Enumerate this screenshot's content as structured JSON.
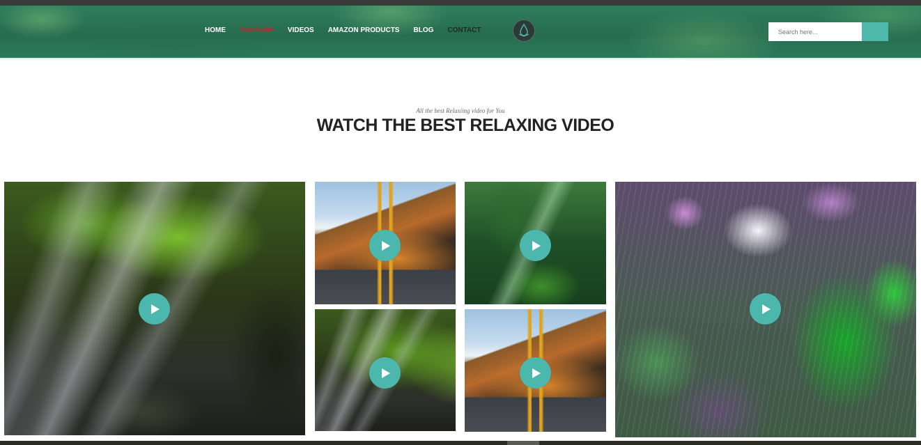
{
  "nav": {
    "items": [
      {
        "label": "HOME"
      },
      {
        "label": "YOUTUBE"
      },
      {
        "label": "VIDEOS"
      },
      {
        "label": "AMAZON PRODUCTS"
      },
      {
        "label": "BLOG"
      },
      {
        "label": "CONTACT"
      }
    ],
    "active": "YOUTUBE"
  },
  "logo": {
    "icon": "lotus-drop-icon"
  },
  "search": {
    "placeholder": "Search here...",
    "button_icon": "search-icon"
  },
  "section": {
    "subtitle": "All the best Relaxiing video for You",
    "title": "WATCH THE BEST RELAXING VIDEO"
  },
  "videos": [
    {
      "scene": "sunbeams through tropical forest",
      "play_icon": "play-icon"
    },
    {
      "scene": "mountain road at sunset",
      "play_icon": "play-icon"
    },
    {
      "scene": "sunlit green forest",
      "play_icon": "play-icon"
    },
    {
      "scene": "sunbeams through tropical forest",
      "play_icon": "play-icon"
    },
    {
      "scene": "mountain road at sunset",
      "play_icon": "play-icon"
    },
    {
      "scene": "rain falling on green plant with purple flowers",
      "play_icon": "play-icon"
    }
  ],
  "colors": {
    "accent": "#4cb7ad",
    "active_nav": "#d4202a",
    "title": "#222222"
  }
}
